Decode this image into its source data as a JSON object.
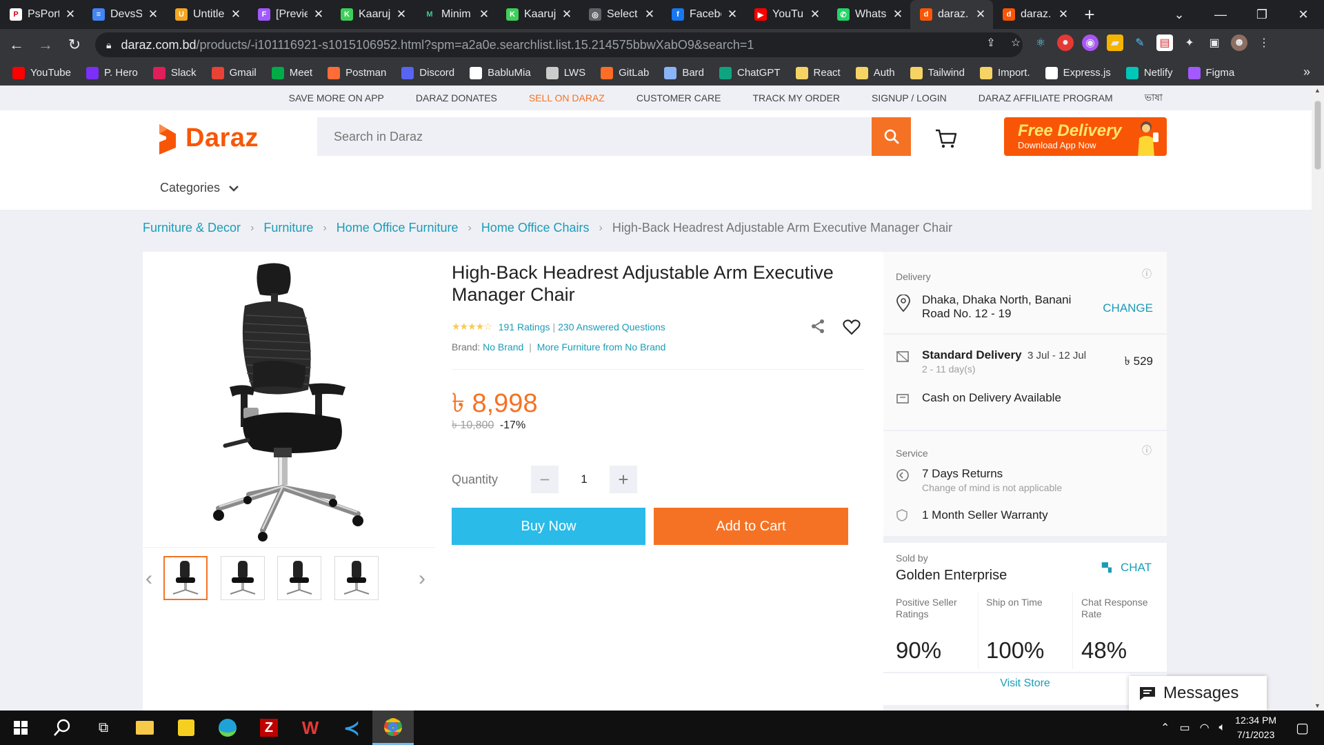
{
  "browser": {
    "tabs": [
      {
        "title": "PsPort",
        "color": "#ffffff",
        "letter": "P",
        "fg": "#d0021b"
      },
      {
        "title": "DevsS",
        "color": "#4285f4",
        "letter": "≡",
        "fg": "#ffffff"
      },
      {
        "title": "Untitle",
        "color": "#f5a623",
        "letter": "U",
        "fg": "#ffffff"
      },
      {
        "title": "[Previe",
        "color": "#a259ff",
        "letter": "F",
        "fg": "#ffffff"
      },
      {
        "title": "Kaaruj",
        "color": "#3ecf5a",
        "letter": "K",
        "fg": "#ffffff"
      },
      {
        "title": "Minim",
        "color": "#202124",
        "letter": "M",
        "fg": "#3ecf8e"
      },
      {
        "title": "Kaaruj",
        "color": "#3ecf5a",
        "letter": "K",
        "fg": "#ffffff"
      },
      {
        "title": "Select",
        "color": "#5f6368",
        "letter": "◎",
        "fg": "#ffffff"
      },
      {
        "title": "Facebo",
        "color": "#1877f2",
        "letter": "f",
        "fg": "#ffffff"
      },
      {
        "title": "YouTu",
        "color": "#ff0000",
        "letter": "▶",
        "fg": "#ffffff"
      },
      {
        "title": "Whats",
        "color": "#25d366",
        "letter": "✆",
        "fg": "#ffffff"
      },
      {
        "title": "daraz.",
        "color": "#f85606",
        "letter": "d",
        "fg": "#ffffff",
        "active": true
      },
      {
        "title": "daraz.",
        "color": "#f85606",
        "letter": "d",
        "fg": "#ffffff"
      }
    ],
    "url_host": "daraz.com.bd",
    "url_path": "/products/-i101116921-s1015106952.html?spm=a2a0e.searchlist.list.15.214575bbwXabO9&search=1",
    "bookmarks": [
      {
        "label": "YouTube",
        "color": "#ff0000"
      },
      {
        "label": "P. Hero",
        "color": "#7b2ff7"
      },
      {
        "label": "Slack",
        "color": "#e01e5a"
      },
      {
        "label": "Gmail",
        "color": "#ea4335"
      },
      {
        "label": "Meet",
        "color": "#00ac47"
      },
      {
        "label": "Postman",
        "color": "#ff6c37"
      },
      {
        "label": "Discord",
        "color": "#5865f2"
      },
      {
        "label": "BabluMia",
        "color": "#ffffff"
      },
      {
        "label": "LWS",
        "color": "#cccccc"
      },
      {
        "label": "GitLab",
        "color": "#fc6d26"
      },
      {
        "label": "Bard",
        "color": "#8ab4f8"
      },
      {
        "label": "ChatGPT",
        "color": "#10a37f"
      },
      {
        "label": "React",
        "color": "#f6d365"
      },
      {
        "label": "Auth",
        "color": "#f6d365"
      },
      {
        "label": "Tailwind",
        "color": "#f6d365"
      },
      {
        "label": "Import.",
        "color": "#f6d365"
      },
      {
        "label": "Express.js",
        "color": "#ffffff"
      },
      {
        "label": "Netlify",
        "color": "#00c7b7"
      },
      {
        "label": "Figma",
        "color": "#a259ff"
      }
    ]
  },
  "topbar": {
    "links": [
      "SAVE MORE ON APP",
      "DARAZ DONATES",
      "SELL ON DARAZ",
      "CUSTOMER CARE",
      "TRACK MY ORDER",
      "SIGNUP / LOGIN",
      "DARAZ AFFILIATE PROGRAM",
      "ভাষা"
    ]
  },
  "header": {
    "logo_text": "Daraz",
    "search_placeholder": "Search in Daraz",
    "promo_title": "Free Delivery",
    "promo_sub": "Download App Now",
    "categories": "Categories"
  },
  "breadcrumb": [
    "Furniture & Decor",
    "Furniture",
    "Home Office Furniture",
    "Home Office Chairs"
  ],
  "breadcrumb_current": "High-Back Headrest Adjustable Arm Executive Manager Chair",
  "product": {
    "title": "High-Back Headrest Adjustable Arm Executive Manager Chair",
    "stars": "★★★★☆",
    "ratings": "191 Ratings",
    "questions": "230 Answered Questions",
    "brand_label": "Brand:",
    "brand": "No Brand",
    "more_from": "More Furniture from No Brand",
    "price": "৳ 8,998",
    "old_price": "৳ 10,800",
    "discount": "-17%",
    "quantity_label": "Quantity",
    "quantity": "1",
    "buy_now": "Buy Now",
    "add_to_cart": "Add to Cart"
  },
  "delivery": {
    "title": "Delivery",
    "location": "Dhaka, Dhaka North, Banani Road No. 12 - 19",
    "change": "CHANGE",
    "standard": "Standard Delivery",
    "standard_dates": "3 Jul - 12 Jul",
    "standard_days": "2 - 11 day(s)",
    "fee": "৳ 529",
    "cod": "Cash on Delivery Available"
  },
  "service": {
    "title": "Service",
    "returns": "7 Days Returns",
    "returns_sub": "Change of mind is not applicable",
    "warranty": "1 Month Seller Warranty"
  },
  "seller": {
    "sold_by": "Sold by",
    "name": "Golden Enterprise",
    "chat": "CHAT",
    "stats": [
      {
        "label": "Positive Seller Ratings",
        "value": "90%"
      },
      {
        "label": "Ship on Time",
        "value": "100%"
      },
      {
        "label": "Chat Response Rate",
        "value": "48%"
      }
    ],
    "visit": "Visit Store"
  },
  "messages": "Messages",
  "taskbar": {
    "time": "12:34 PM",
    "date": "7/1/2023"
  }
}
